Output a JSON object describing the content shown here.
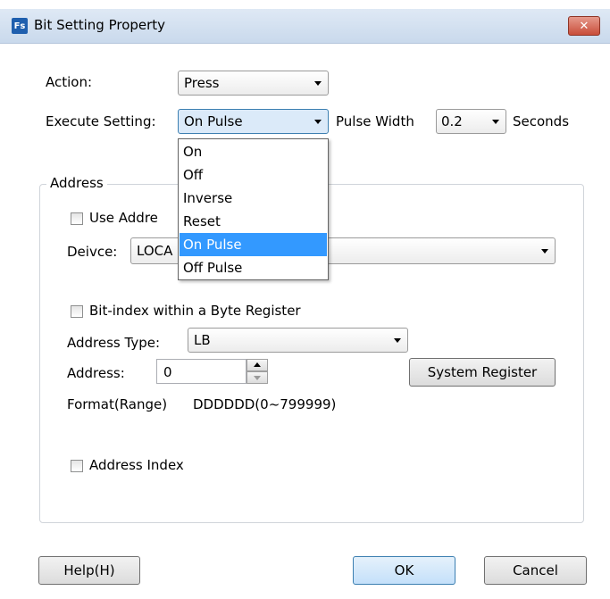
{
  "window": {
    "title": "Bit Setting Property",
    "app_icon": "Fs",
    "close_symbol": "✕"
  },
  "action": {
    "label": "Action:",
    "value": "Press"
  },
  "execute": {
    "label": "Execute Setting:",
    "value": "On Pulse",
    "options": [
      "On",
      "Off",
      "Inverse",
      "Reset",
      "On Pulse",
      "Off Pulse"
    ],
    "selected_option": "On Pulse"
  },
  "pulse": {
    "label": "Pulse Width",
    "value": "0.2",
    "unit_label": "Seconds"
  },
  "address_group": {
    "legend": "Address",
    "use_address_label": "Use Addre",
    "device_label": "Deivce:",
    "device_value": "LOCA",
    "bit_index_label": "Bit-index within a Byte Register",
    "address_type_label": "Address Type:",
    "address_type_value": "LB",
    "address_label": "Address:",
    "address_value": "0",
    "system_register_button": "System Register",
    "format_label": "Format(Range)",
    "format_value": "DDDDDD(0~799999)",
    "address_index_label": "Address Index"
  },
  "buttons": {
    "help": "Help(H)",
    "ok": "OK",
    "cancel": "Cancel"
  }
}
